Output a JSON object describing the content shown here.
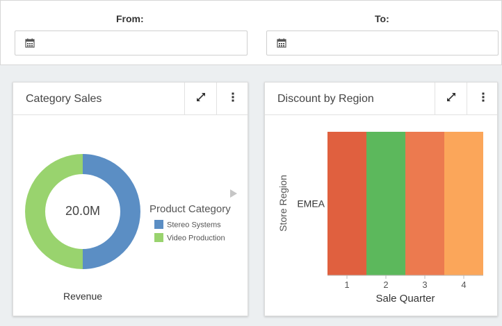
{
  "filters": {
    "from_label": "From:",
    "to_label": "To:",
    "from_value": "",
    "to_value": ""
  },
  "icons": {
    "calendar": "calendar-icon",
    "expand": "expand-icon",
    "menu": "vertical-dots-menu-icon",
    "legend_next": "triangle-right-icon"
  },
  "category_sales": {
    "title": "Category Sales",
    "center_value": "20.0M",
    "xlabel": "Revenue",
    "legend_title": "Product Category"
  },
  "discount_by_region": {
    "title": "Discount by Region",
    "ylabel": "Store Region",
    "xlabel": "Sale Quarter"
  },
  "chart_data": [
    {
      "type": "pie",
      "title": "Category Sales",
      "xlabel": "Revenue",
      "center_label": "20.0M",
      "legend_title": "Product Category",
      "legend_placement": "right",
      "categories": [
        "Stereo Systems",
        "Video Production"
      ],
      "values": [
        50,
        50
      ],
      "colors": [
        "#5b8ec4",
        "#99d36e"
      ]
    },
    {
      "type": "heatmap",
      "title": "Discount by Region",
      "xlabel": "Sale Quarter",
      "ylabel": "Store Region",
      "x": [
        "1",
        "2",
        "3",
        "4"
      ],
      "y": [
        "EMEA"
      ],
      "colors": [
        "#e0603f",
        "#5cb85c",
        "#ec7a4f",
        "#fba65a"
      ]
    }
  ]
}
